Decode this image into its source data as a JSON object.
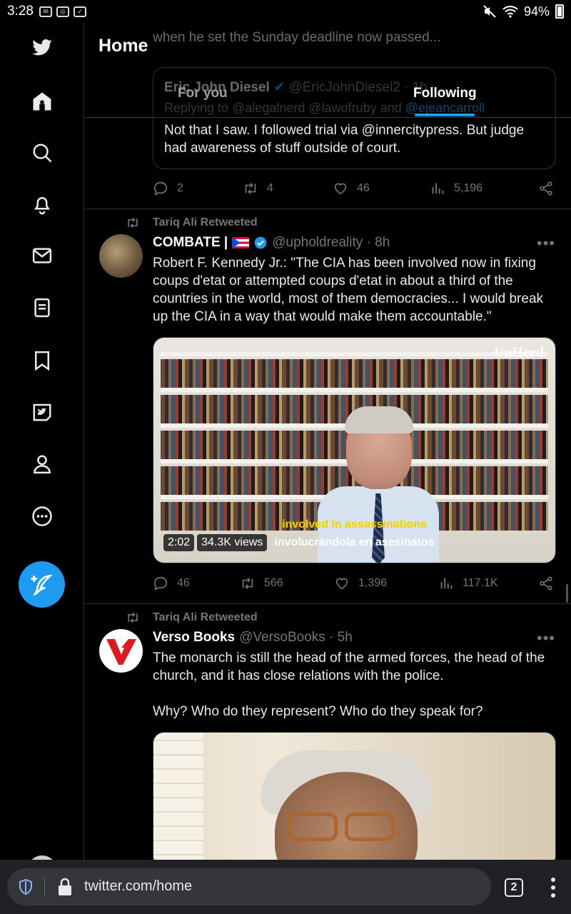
{
  "status_bar": {
    "time": "3:28",
    "battery": "94%"
  },
  "sidebar": {
    "items": [
      "home-icon",
      "search-icon",
      "bell-icon",
      "mail-icon",
      "lists-icon",
      "bookmark-icon",
      "twitter-blue-icon",
      "profile-icon",
      "more-icon"
    ],
    "compose": "compose-icon"
  },
  "header": {
    "title": "Home",
    "tabs": [
      {
        "label": "For you"
      },
      {
        "label": "Following"
      }
    ]
  },
  "tweet_partial": {
    "text_fragment": "when he set the Sunday deadline now passed...",
    "quote": {
      "author": "Eric John Diesel",
      "handle": "@EricJohnDiesel2 · 1h",
      "replying_prefix": "Replying to @alegalnerd @lawofruby and",
      "replying_last": "@ejeancarroll",
      "text": "Not that I saw. I followed trial via @innercitypress. But judge had awareness of stuff outside of court."
    },
    "stats": {
      "replies": "2",
      "retweets": "4",
      "likes": "46",
      "views": "5,196"
    }
  },
  "tweet_combate": {
    "retweeted_by": "Tariq Ali Retweeted",
    "name": "COMBATE |",
    "handle": "@upholdreality · 8h",
    "text": "Robert F. Kennedy Jr.: \"The CIA has been involved now in fixing coups d'etat or attempted coups d'etat in about a third of the countries in the world, most of them democracies... I would break up the CIA in a way that would make them accountable.\"",
    "video": {
      "watermark": "UnHerd",
      "caption_en": "involved in assassinations",
      "caption_es": "involucrándola en asesinatos",
      "duration": "2:02",
      "views": "34.3K views"
    },
    "stats": {
      "replies": "46",
      "retweets": "566",
      "likes": "1,396",
      "views": "117.1K"
    }
  },
  "tweet_verso": {
    "retweeted_by": "Tariq Ali Retweeted",
    "name": "Verso Books",
    "handle": "@VersoBooks · 5h",
    "text": "The monarch is still the head of the armed forces, the head of the church, and it has close relations with the police.\n\nWhy? Who do they represent? Who do they speak for?"
  },
  "browser": {
    "url": "twitter.com/home",
    "tab_count": "2"
  },
  "colors": {
    "accent": "#1d9bf0",
    "background": "#000000",
    "muted": "#71767b"
  }
}
